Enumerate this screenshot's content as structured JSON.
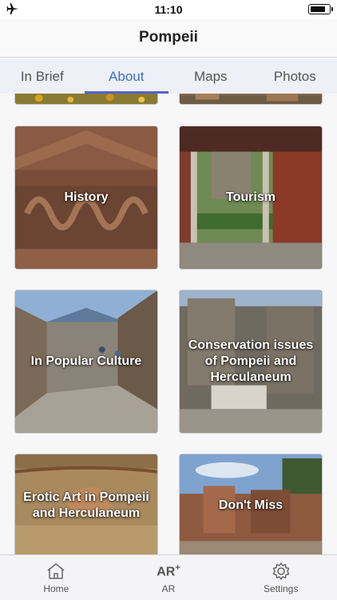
{
  "status_bar": {
    "time": "11:10"
  },
  "nav": {
    "title": "Pompeii"
  },
  "tabs": [
    {
      "label": "In Brief"
    },
    {
      "label": "About"
    },
    {
      "label": "Maps"
    },
    {
      "label": "Photos"
    }
  ],
  "cards": [
    {
      "label": "History"
    },
    {
      "label": "Tourism"
    },
    {
      "label": "In Popular Culture"
    },
    {
      "label": "Conservation issues of Pompeii and Herculaneum"
    },
    {
      "label": "Erotic Art in Pompeii and Herculaneum"
    },
    {
      "label": "Don't Miss"
    }
  ],
  "tab_bar": [
    {
      "label": "Home",
      "icon": "home-icon"
    },
    {
      "label": "AR",
      "icon": "ar-icon",
      "icon_text": "AR",
      "icon_sup": "+"
    },
    {
      "label": "Settings",
      "icon": "gear-icon"
    }
  ],
  "colors": {
    "accent": "#3a6fd0",
    "tab_indicator": "#5563c9"
  }
}
